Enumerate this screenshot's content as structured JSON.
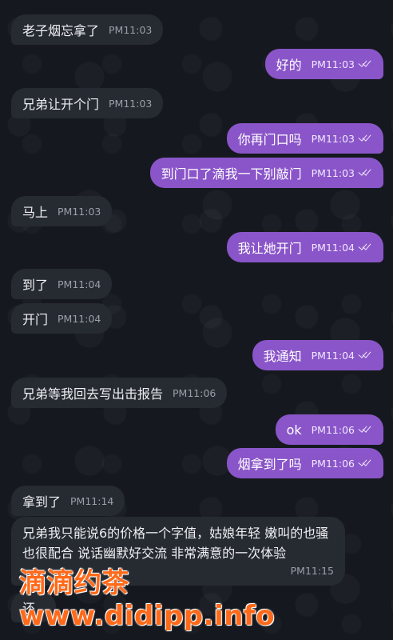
{
  "messages": [
    {
      "dir": "in",
      "text": "老子烟忘拿了",
      "time": "PM11:03"
    },
    {
      "dir": "out",
      "text": "好的",
      "time": "PM11:03"
    },
    {
      "dir": "in",
      "text": "兄弟让开个门",
      "time": "PM11:03"
    },
    {
      "dir": "out",
      "text": "你再门口吗",
      "time": "PM11:03"
    },
    {
      "dir": "out",
      "text": "到门口了滴我一下别敲门",
      "time": "PM11:03"
    },
    {
      "dir": "in",
      "text": "马上",
      "time": "PM11:03"
    },
    {
      "dir": "out",
      "text": "我让她开门",
      "time": "PM11:04"
    },
    {
      "dir": "in",
      "text": "到了",
      "time": "PM11:04"
    },
    {
      "dir": "in",
      "text": "开门",
      "time": "PM11:04"
    },
    {
      "dir": "out",
      "text": "我通知",
      "time": "PM11:04"
    },
    {
      "dir": "in",
      "text": "兄弟等我回去写出击报告",
      "time": "PM11:06"
    },
    {
      "dir": "out",
      "text": "ok",
      "time": "PM11:06"
    },
    {
      "dir": "out",
      "text": "烟拿到了吗",
      "time": "PM11:06"
    },
    {
      "dir": "in",
      "text": "拿到了",
      "time": "PM11:14"
    },
    {
      "dir": "in",
      "text": "兄弟我只能说6的价格一个字值，姑娘年轻 嫩叫的也骚 也很配合 说话幽默好交流 非常满意的一次体验",
      "time": "PM11:15"
    },
    {
      "dir": "in",
      "text": "还",
      "time": ""
    }
  ],
  "watermark": "滴滴约茶 www.didipp.info",
  "colors": {
    "incoming": "#262a31",
    "outgoing": "#8a55c9",
    "background": "#15191f",
    "watermark": "#ff6a1a"
  }
}
